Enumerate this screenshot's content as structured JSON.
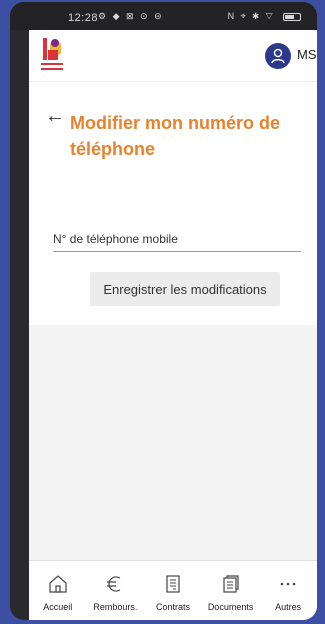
{
  "status_bar": {
    "time": "12:28",
    "left_icons": "⚙ ◆ ⊠ ⊙ ⊖",
    "right_icons": "N ⌖ ✱ ▽"
  },
  "header": {
    "logo_icon": "organization-logo",
    "avatar_icon": "user-icon",
    "user_initials": "MS",
    "avatar_color": "#2c3a8c"
  },
  "page": {
    "back_icon": "back-arrow-icon",
    "title": "Modifier mon numéro de téléphone",
    "title_color": "#e8822d",
    "phone_field": {
      "placeholder": "N° de téléphone mobile",
      "value": ""
    },
    "save_button_label": "Enregistrer les modifications"
  },
  "bottom_nav": {
    "items": [
      {
        "label": "Accueil",
        "icon": "home-icon"
      },
      {
        "label": "Rembours.",
        "icon": "euro-icon"
      },
      {
        "label": "Contrats",
        "icon": "contract-icon"
      },
      {
        "label": "Documents",
        "icon": "documents-icon"
      },
      {
        "label": "Autres",
        "icon": "more-icon"
      }
    ]
  }
}
